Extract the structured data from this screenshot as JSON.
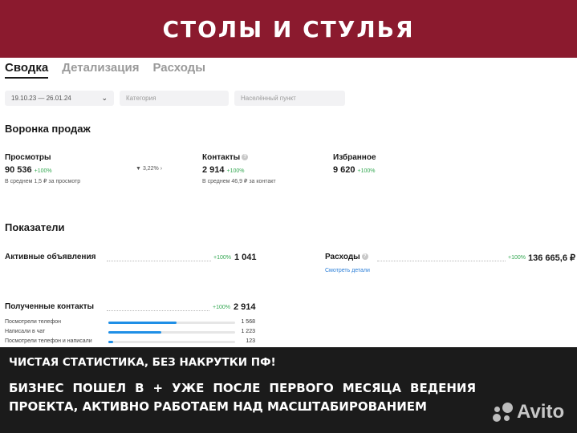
{
  "banner": {
    "title": "Столы и стулья"
  },
  "tabs": [
    {
      "label": "Сводка",
      "active": true
    },
    {
      "label": "Детализация",
      "active": false
    },
    {
      "label": "Расходы",
      "active": false
    }
  ],
  "filters": {
    "date_range": "19.10.23 — 26.01.24",
    "category_placeholder": "Категория",
    "locality_placeholder": "Населённый пункт"
  },
  "funnel": {
    "title": "Воронка продаж",
    "views": {
      "label": "Просмотры",
      "value": "90 536",
      "delta": "+100%",
      "sub": "В среднем 1,5 ₽ за просмотр"
    },
    "conversion": "3,22%",
    "contacts": {
      "label": "Контакты",
      "value": "2 914",
      "delta": "+100%",
      "sub": "В среднем 46,9 ₽ за контакт"
    },
    "favorites": {
      "label": "Избранное",
      "value": "9 620",
      "delta": "+100%"
    }
  },
  "indicators": {
    "title": "Показатели",
    "active_ads": {
      "label": "Активные объявления",
      "delta": "+100%",
      "value": "1 041"
    },
    "expenses": {
      "label": "Расходы",
      "delta": "+100%",
      "value": "136 665,6 ₽",
      "link": "Смотреть детали"
    },
    "received_contacts": {
      "label": "Полученные контакты",
      "delta": "+100%",
      "value": "2 914",
      "rows": [
        {
          "label": "Посмотрели телефон",
          "value": "1 568",
          "fraction": 0.54
        },
        {
          "label": "Написали в чат",
          "value": "1 223",
          "fraction": 0.42
        },
        {
          "label": "Посмотрели телефон и написали",
          "value": "123",
          "fraction": 0.04
        }
      ]
    }
  },
  "bottom": {
    "line1": "Чистая статистика, без накрутки ПФ!",
    "line2": "Бизнес пошел в + уже после первого месяца ведения",
    "line3": "проекта, активно работаем над масштабированием"
  },
  "logo": {
    "text": "Avito"
  },
  "colors": {
    "banner": "#8b1a2e",
    "positive": "#35a853",
    "link": "#2c7fd8",
    "bar": "#1f8fe6",
    "bottom": "#1b1b1b"
  }
}
